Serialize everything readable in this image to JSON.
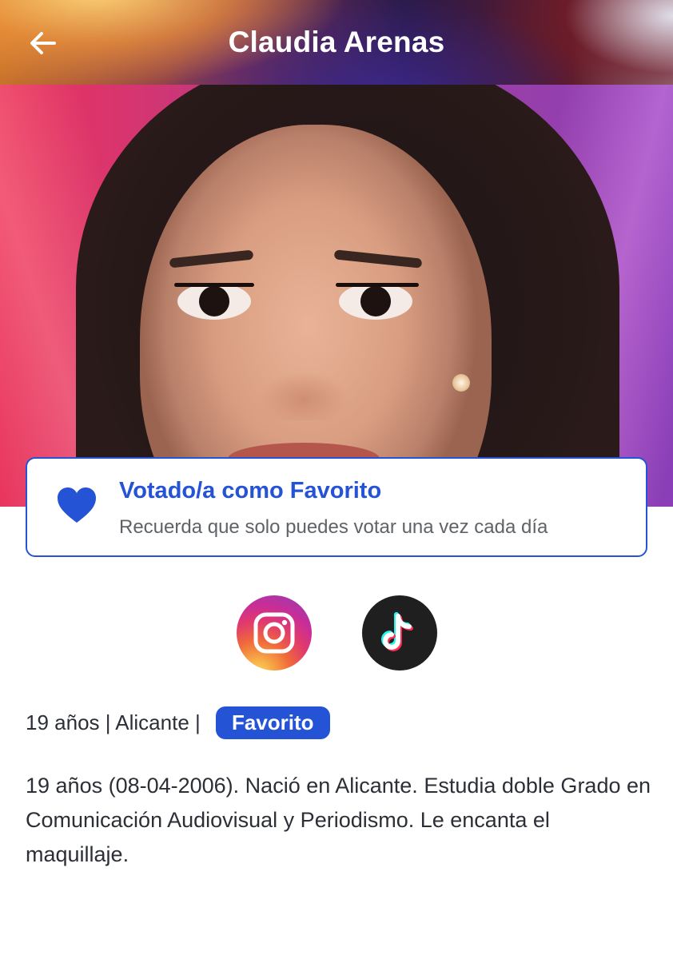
{
  "header": {
    "title": "Claudia Arenas",
    "back_icon": "arrow-left-icon"
  },
  "vote": {
    "icon": "heart-icon",
    "title": "Votado/a como Favorito",
    "subtitle": "Recuerda que solo puedes votar una vez cada día",
    "accent_color": "#2453d6"
  },
  "social": [
    {
      "name": "instagram",
      "icon": "instagram-icon"
    },
    {
      "name": "tiktok",
      "icon": "tiktok-icon"
    }
  ],
  "profile": {
    "meta": "19 años | Alicante | ",
    "badge": "Favorito",
    "bio": "19 años (08-04-2006). Nació en Alicante. Estudia doble Grado en Comunicación Audiovisual y Periodismo. Le encanta el maquillaje."
  }
}
